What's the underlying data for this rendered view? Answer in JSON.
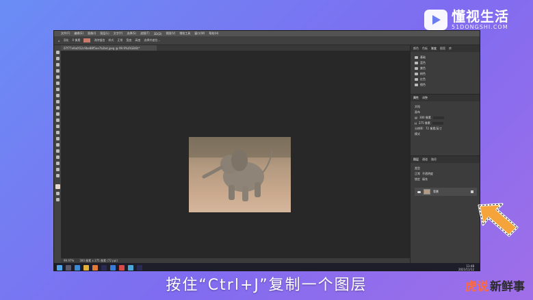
{
  "brand": {
    "name": "懂视生活",
    "site": "51DONGSHI.COM"
  },
  "photoshop": {
    "menus": [
      "文件(F)",
      "编辑(E)",
      "图像(I)",
      "图层(L)",
      "文字(Y)",
      "选择(S)",
      "滤镜(T)",
      "3D(D)",
      "视图(V)",
      "增效工具",
      "窗口(W)",
      "帮助(H)"
    ],
    "options_bar": [
      "羽化",
      "0 像素",
      "消除锯齿",
      "样式",
      "正常",
      "宽度",
      "高度",
      "选择并遮住..."
    ],
    "document_tab": "07f77e9a0f32c9be88f5ee7b2bd.jpeg @ 99.9%(RGB/8)*",
    "status": [
      "99.97%",
      "300 像素 x 275 像素 (72 ppi)"
    ],
    "top_panel_tabs": [
      "颜色",
      "色板",
      "渐变",
      "图案",
      "库"
    ],
    "top_panel_active": "渐变",
    "swatch_groups": [
      "基础",
      "蓝色",
      "紫色",
      "粉色",
      "红色",
      "橙色"
    ],
    "properties_tabs": [
      "属性",
      "调整"
    ],
    "properties": {
      "doc_label": "文档",
      "canvas_label": "画布",
      "width": "300 像素",
      "height": "275 像素",
      "resolution": "分辨率：72 像素/英寸",
      "mode_label": "模式"
    },
    "layers_tabs": [
      "图层",
      "通道",
      "路径"
    ],
    "layers_filter": "类型",
    "layers_mode": "正常",
    "layers_opacity": "不透明度",
    "layers_lock": "锁定",
    "layers_fill": "填充",
    "layer_name": "背景"
  },
  "taskbar": {
    "time": "11:48",
    "date": "2021/11/12"
  },
  "subtitle": "按住“Ctrl+J”复制一个图层",
  "watermark": {
    "part_a": "虎说",
    "part_b": "新鲜事"
  }
}
